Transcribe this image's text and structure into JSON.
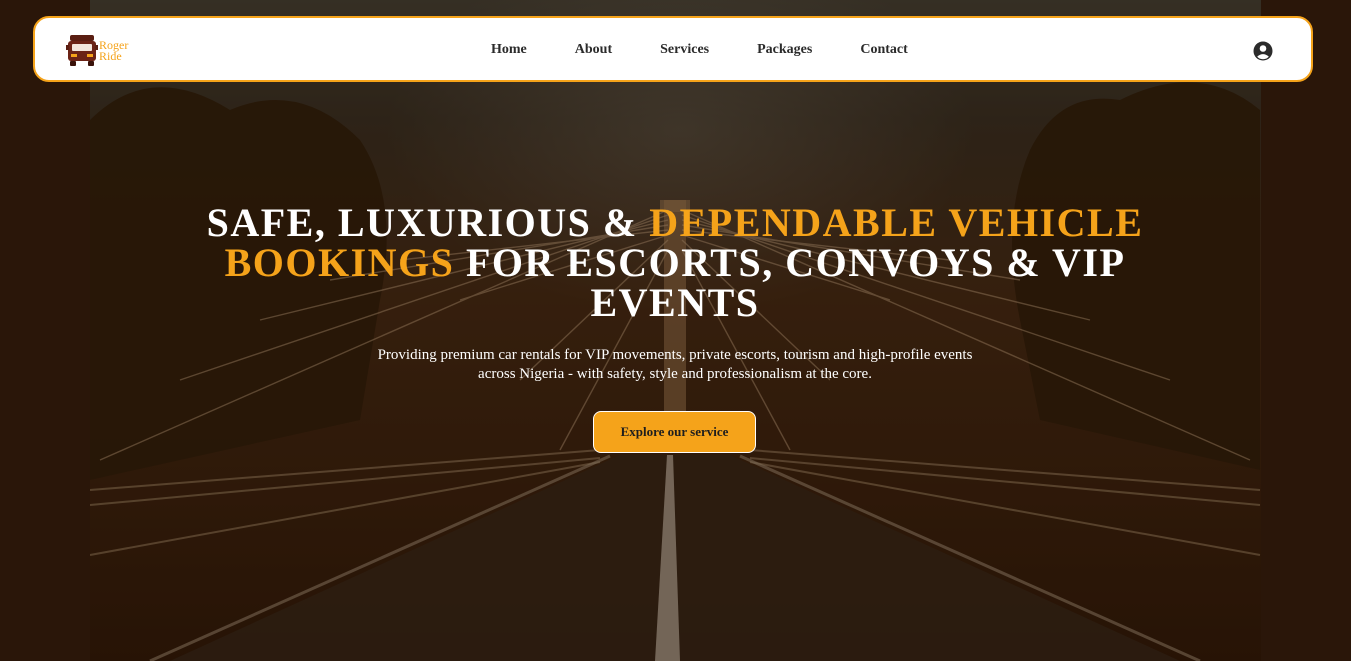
{
  "brand": {
    "logo_icon": "truck-icon",
    "name_line1": "Roger",
    "name_line2": "Ride",
    "accent_color": "#f5a31a"
  },
  "nav": {
    "items": [
      {
        "label": "Home"
      },
      {
        "label": "About"
      },
      {
        "label": "Services"
      },
      {
        "label": "Packages"
      },
      {
        "label": "Contact"
      }
    ],
    "account_icon": "user-circle-icon"
  },
  "hero": {
    "title_part1": "SAFE, LUXURIOUS & ",
    "title_highlight": "DEPENDABLE VEHICLE BOOKINGS",
    "title_part2": " FOR ESCORTS, CONVOYS & VIP EVENTS",
    "subtitle": "Providing premium car rentals for VIP movements, private escorts, tourism and high-profile events across Nigeria - with safety, style and professionalism at the core.",
    "cta_label": "Explore our service",
    "background_image": "bridge-road-photo"
  }
}
